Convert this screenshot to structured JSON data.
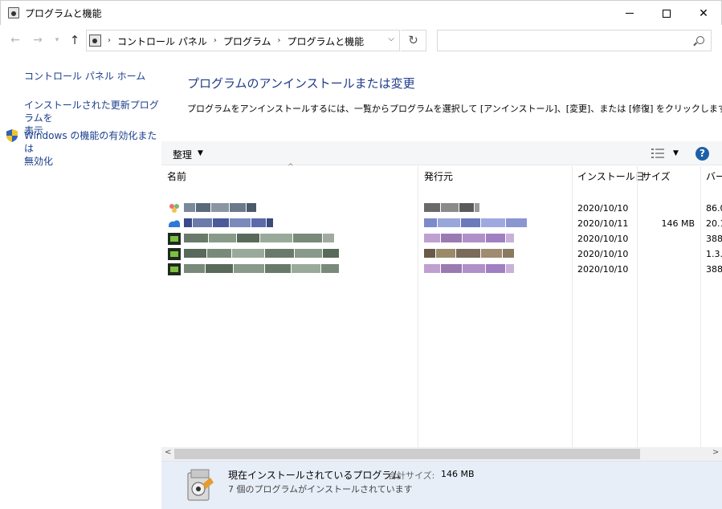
{
  "window": {
    "title": "プログラムと機能",
    "minimize": "minimize",
    "maximize": "maximize",
    "close": "✕"
  },
  "nav": {
    "back": "←",
    "forward": "→",
    "recent": "▾",
    "up": "↑",
    "breadcrumbs": [
      "コントロール パネル",
      "プログラム",
      "プログラムと機能"
    ],
    "separator": "›",
    "address_drop": "⌵",
    "refresh": "↻",
    "search_placeholder": ""
  },
  "sidebar": {
    "home": "コントロール パネル ホーム",
    "updates_line1": "インストールされた更新プログラムを",
    "updates_line2": "表示",
    "features_line1": "Windows の機能の有効化または",
    "features_line2": "無効化"
  },
  "content": {
    "title": "プログラムのアンインストールまたは変更",
    "description": "プログラムをアンインストールするには、一覧からプログラムを選択して [アンインストール]、[変更]、または [修復] をクリックします。"
  },
  "toolbar": {
    "organize": "整理",
    "organize_drop": "▼",
    "view_drop": "▼",
    "help": "?"
  },
  "columns": {
    "name": "名前",
    "publisher": "発行元",
    "installed_on": "インストール日",
    "size": "サイズ",
    "version": "バー"
  },
  "rows": [
    {
      "date": "2020/10/10",
      "size": "",
      "version": "86.0"
    },
    {
      "date": "2020/10/11",
      "size": "146 MB",
      "version": "20.1"
    },
    {
      "date": "2020/10/10",
      "size": "",
      "version": "388"
    },
    {
      "date": "2020/10/10",
      "size": "",
      "version": "1.3."
    },
    {
      "date": "2020/10/10",
      "size": "",
      "version": "388"
    }
  ],
  "scroll": {
    "left": "<",
    "right": ">"
  },
  "details": {
    "title": "現在インストールされているプログラム",
    "size_label": "合計サイズ:",
    "size_value": "146 MB",
    "count": "7 個のプログラムがインストールされています"
  },
  "colors": {
    "link": "#1a3e8c",
    "title_blue": "#1e3a8a",
    "details_bg": "#e8eef8",
    "help_blue": "#1f5fa8"
  }
}
